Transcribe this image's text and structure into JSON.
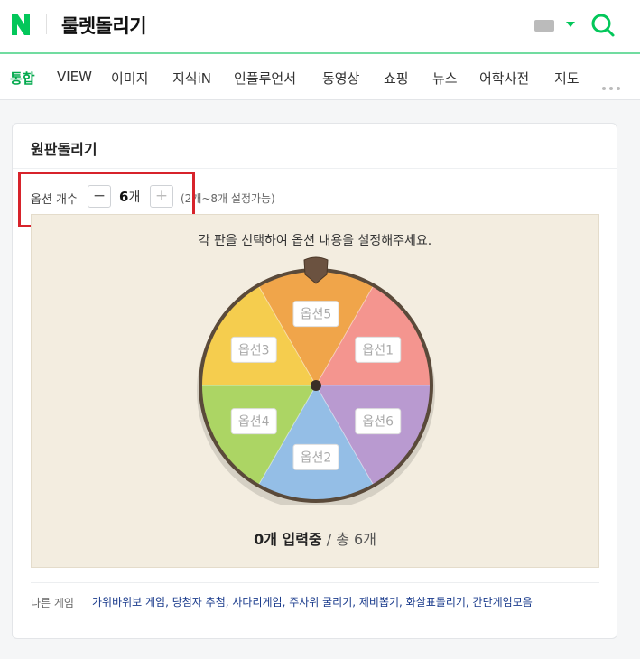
{
  "header": {
    "logo": "N",
    "query": "룰렛돌리기",
    "keyboard_icon": "keyboard-icon",
    "search_icon": "search-icon",
    "brand_color": "#03c75a"
  },
  "tabs": [
    {
      "label": "통합",
      "active": true
    },
    {
      "label": "VIEW"
    },
    {
      "label": "이미지"
    },
    {
      "label": "지식iN"
    },
    {
      "label": "인플루언서"
    },
    {
      "label": "동영상"
    },
    {
      "label": "쇼핑"
    },
    {
      "label": "뉴스"
    },
    {
      "label": "어학사전"
    },
    {
      "label": "지도"
    }
  ],
  "card": {
    "title": "원판돌리기",
    "option_label": "옵션 개수",
    "minus_label": "−",
    "plus_label": "+",
    "count": "6",
    "count_unit": "개",
    "hint": "(2개~8개 설정가능)",
    "instruction": "각 판을 선택하여 옵션 내용을 설정해주세요.",
    "status_count": "0개 입력중",
    "status_total": " / 총 6개",
    "other_label": "다른 게임",
    "other_games": "가위바위보 게임, 당첨자 추첨, 사다리게임, 주사위 굴리기, 제비뽑기, 화살표돌리기, 간단게임모음"
  },
  "wheel": {
    "slices": [
      {
        "label": "옵션5",
        "color": "#f0a54a"
      },
      {
        "label": "옵션1",
        "color": "#f4958f"
      },
      {
        "label": "옵션6",
        "color": "#b99ad0"
      },
      {
        "label": "옵션2",
        "color": "#94bee6"
      },
      {
        "label": "옵션4",
        "color": "#acd564"
      },
      {
        "label": "옵션3",
        "color": "#f5cd4e"
      }
    ],
    "rim_color": "#5a4a3a"
  }
}
